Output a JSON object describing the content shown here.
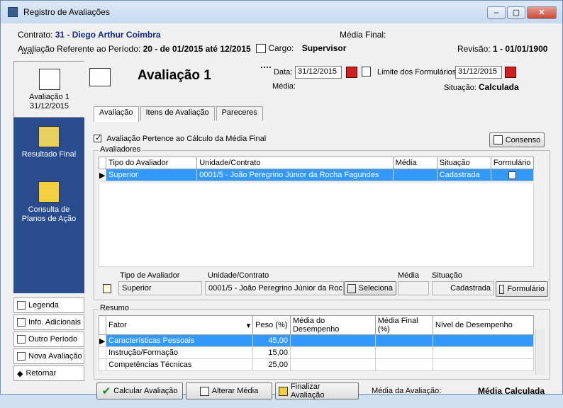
{
  "window": {
    "title": "Registro de Avaliações"
  },
  "header": {
    "contrato_label": "Contrato:",
    "contrato_value": "31 - Diego Arthur Coimbra",
    "media_final_label": "Média Final:",
    "periodo_label": "Avaliação Referente ao Período:",
    "periodo_value": "20 - de 01/2015 até 12/2015",
    "cargo_label": "Cargo:",
    "cargo_value": "Supervisor",
    "revisao_label": "Revisão:",
    "revisao_value": "1 - 01/01/1900"
  },
  "sidebar": {
    "items": [
      {
        "label": "Avaliação 1\n31/12/2015"
      },
      {
        "label": "Resultado Final"
      },
      {
        "label": "Consulta de\nPlanos de Ação"
      }
    ],
    "buttons": [
      "Legenda",
      "Info. Adicionais",
      "Outro Período",
      "Nova Avaliação",
      "Retornar"
    ]
  },
  "main": {
    "title": "Avaliação 1",
    "data_label": "Data:",
    "data_value": "31/12/2015",
    "limite_label": "Limite dos Formulários:",
    "limite_value": "31/12/2015",
    "media_label": "Média:",
    "situacao_label": "Situação:",
    "situacao_value": "Calculada",
    "tabs": [
      "Avaliação",
      "Itens de Avaliação",
      "Pareceres"
    ],
    "checkbox_label": "Avaliação Pertence ao Cálculo da Média Final",
    "consenso_button": "Consenso",
    "avaliadores": {
      "title": "Avaliadores",
      "columns": [
        "Tipo do Avaliador",
        "Unidade/Contrato",
        "Média",
        "Situação",
        "Formulário"
      ],
      "rows": [
        {
          "tipo": "Superior",
          "unidade": "0001/5 - João Peregrino Júnior da Rocha Fagundes",
          "media": "",
          "situacao": "Cadastrada"
        }
      ]
    },
    "detail": {
      "tipo_label": "Tipo de Avaliador",
      "unidade_label": "Unidade/Contrato",
      "media_label": "Média",
      "situacao_label": "Situação",
      "tipo_value": "Superior",
      "unidade_value": "0001/5 - João Peregrino Júnior da Roc",
      "seleciona_button": "Seleciona",
      "situacao_value": "Cadastrada",
      "formulario_button": "Formulário"
    },
    "resumo": {
      "title": "Resumo",
      "columns": [
        "Fator",
        "Peso (%)",
        "Média do Desempenho",
        "Média Final (%)",
        "Nível de Desempenho"
      ],
      "rows": [
        {
          "fator": "Características Pessoais",
          "peso": "45,00"
        },
        {
          "fator": "Instrução/Formação",
          "peso": "15,00"
        },
        {
          "fator": "Competências Técnicas",
          "peso": "25,00"
        }
      ]
    },
    "bottom": {
      "calcular": "Calcular Avaliação",
      "alterar": "Alterar Média",
      "finalizar": "Finalizar Avaliação",
      "media_avaliacao_label": "Média da Avaliação:",
      "media_avaliacao_value": "Média Calculada"
    }
  }
}
